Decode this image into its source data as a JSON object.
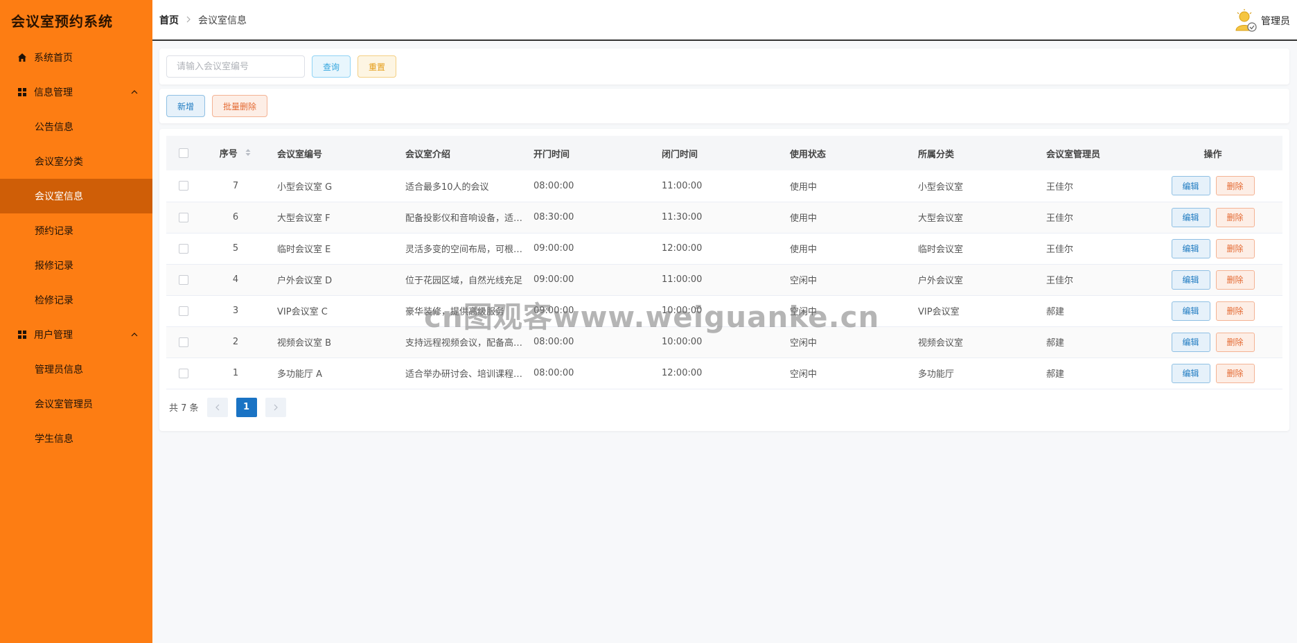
{
  "app": {
    "title": "会议室预约系统"
  },
  "sidebar": {
    "home": "系统首页",
    "groups": [
      {
        "label": "信息管理",
        "items": [
          "公告信息",
          "会议室分类",
          "会议室信息",
          "预约记录",
          "报修记录",
          "检修记录"
        ]
      },
      {
        "label": "用户管理",
        "items": [
          "管理员信息",
          "会议室管理员",
          "学生信息"
        ]
      }
    ],
    "active_item": "会议室信息"
  },
  "breadcrumb": {
    "home": "首页",
    "current": "会议室信息"
  },
  "user": {
    "name": "管理员"
  },
  "search": {
    "placeholder": "请输入会议室编号",
    "value": "",
    "query_label": "查询",
    "reset_label": "重置"
  },
  "actions": {
    "add_label": "新增",
    "batch_delete_label": "批量删除"
  },
  "table": {
    "columns": [
      "序号",
      "会议室编号",
      "会议室介绍",
      "开门时间",
      "闭门时间",
      "使用状态",
      "所属分类",
      "会议室管理员",
      "操作"
    ],
    "rows": [
      {
        "id": "7",
        "code": "小型会议室 G",
        "intro": "适合最多10人的会议",
        "open": "08:00:00",
        "close": "11:00:00",
        "status": "使用中",
        "category": "小型会议室",
        "manager": "王佳尔"
      },
      {
        "id": "6",
        "code": "大型会议室 F",
        "intro": "配备投影仪和音响设备，适合大型会议",
        "open": "08:30:00",
        "close": "11:30:00",
        "status": "使用中",
        "category": "大型会议室",
        "manager": "王佳尔"
      },
      {
        "id": "5",
        "code": "临时会议室 E",
        "intro": "灵活多变的空间布局，可根据需求调整",
        "open": "09:00:00",
        "close": "12:00:00",
        "status": "使用中",
        "category": "临时会议室",
        "manager": "王佳尔"
      },
      {
        "id": "4",
        "code": "户外会议室 D",
        "intro": "位于花园区域，自然光线充足",
        "open": "09:00:00",
        "close": "11:00:00",
        "status": "空闲中",
        "category": "户外会议室",
        "manager": "王佳尔"
      },
      {
        "id": "3",
        "code": "VIP会议室 C",
        "intro": "豪华装修，提供高级服务",
        "open": "09:00:00",
        "close": "10:00:00",
        "status": "空闲中",
        "category": "VIP会议室",
        "manager": "郝建"
      },
      {
        "id": "2",
        "code": "视频会议室 B",
        "intro": "支持远程视频会议，配备高清设备",
        "open": "08:00:00",
        "close": "10:00:00",
        "status": "空闲中",
        "category": "视频会议室",
        "manager": "郝建"
      },
      {
        "id": "1",
        "code": "多功能厅 A",
        "intro": "适合举办研讨会、培训课程等活动",
        "open": "08:00:00",
        "close": "12:00:00",
        "status": "空闲中",
        "category": "多功能厅",
        "manager": "郝建"
      }
    ],
    "edit_label": "编辑",
    "delete_label": "删除"
  },
  "pagination": {
    "total_text": "共 7 条",
    "current_page": "1"
  },
  "watermark": "cn图观客www.weiguanke.cn",
  "colors": {
    "sidebar_bg": "#fd7d13",
    "sidebar_active": "#cf5e07",
    "primary": "#1a73c4"
  }
}
